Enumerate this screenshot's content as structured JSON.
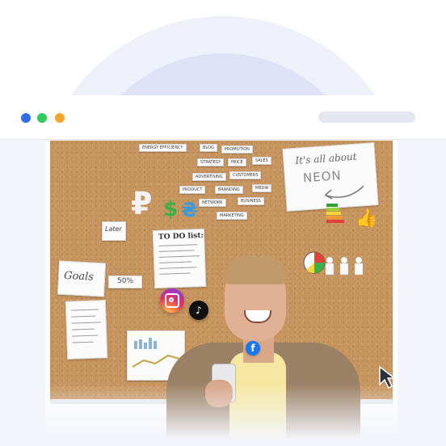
{
  "window": {
    "dots": [
      "#2f6cf0",
      "#2fcc5c",
      "#f6a52b"
    ]
  },
  "board": {
    "neon_card": {
      "line1": "It's all about",
      "line2": "NEON"
    },
    "todo_card": {
      "title": "TO DO list:"
    },
    "goals_card": {
      "text": "Goals"
    },
    "later_card": {
      "text": "Later"
    },
    "percent_card": {
      "text": "50%"
    },
    "tags": [
      "ENERGY EFFICIENCY",
      "BLOG",
      "PROMOTION",
      "STRATEGY",
      "PRICE",
      "SALES",
      "ADVERTISING",
      "CUSTOMERS",
      "PRODUCT",
      "BRANDING",
      "MEDIA",
      "NETWORK",
      "BUSINESS",
      "MARKETING"
    ]
  },
  "social_icons": [
    "instagram-icon",
    "tiktok-icon",
    "facebook-icon"
  ],
  "icons": {
    "tiktok_glyph": "♪",
    "facebook_glyph": "f"
  }
}
